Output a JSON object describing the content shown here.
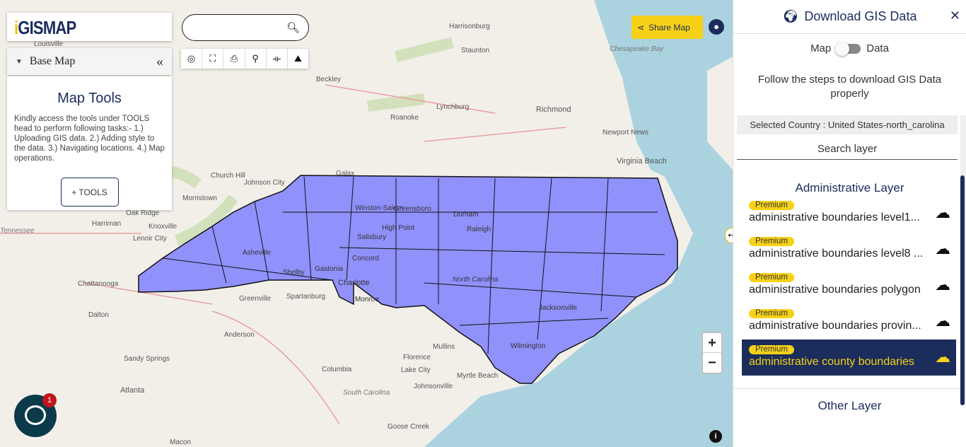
{
  "map": {
    "labels": [
      "Louisville",
      "Harrisonburg",
      "Staunton",
      "Beckley",
      "Lynchburg",
      "Roanoke",
      "Richmond",
      "Chesapeake Bay",
      "Newport News",
      "Virginia Beach",
      "Galax",
      "Church Hill",
      "Johnson City",
      "Morristown",
      "Oak Ridge",
      "Knoxville",
      "Harriman",
      "Lenoir City",
      "Tennessee",
      "Chattanooga",
      "Dalton",
      "Greenville",
      "Spartanburg",
      "Anderson",
      "Atlanta",
      "Sandy Springs",
      "Winston-Salem",
      "Greensboro",
      "Durham",
      "Raleigh",
      "High Point",
      "Salisbury",
      "Asheville",
      "Shelby",
      "Gastonia",
      "Charlotte",
      "Concord",
      "Monroe",
      "Jacksonville",
      "Wilmington",
      "Florence",
      "Lake City",
      "Johnsonville",
      "Myrtle Beach",
      "Mullins",
      "Columbia",
      "South Carolina",
      "North Carolina",
      "Goose Creek",
      "Macon"
    ],
    "region_fill": "#8080ff",
    "region_stroke": "#111111"
  },
  "logo": "iGISMAP",
  "basemap": {
    "label": "Base Map"
  },
  "tools": {
    "title": "Map Tools",
    "description": "Kindly access the tools under TOOLS head to perform following tasks:- 1.) Uploading GIS data. 2.) Adding style to the data. 3.) Navigating locations. 4.) Map operations.",
    "button": "+ TOOLS"
  },
  "search": {
    "placeholder": "",
    "value": ""
  },
  "toolbar": [
    "locate-icon",
    "focus-icon",
    "print-icon",
    "search-icon",
    "measure-icon",
    "layers-icon"
  ],
  "share": {
    "label": "Share Map"
  },
  "chat": {
    "badge": "1"
  },
  "panel": {
    "title": "Download GIS Data",
    "toggle_left": "Map",
    "toggle_right": "Data",
    "steps": "Follow the steps to download GIS Data properly",
    "selected": "Selected Country : United States-north_carolina",
    "search_layer": "Search layer",
    "admin_title": "Administrative Layer",
    "layers": [
      {
        "badge": "Premium",
        "name": "administrative boundaries level1..."
      },
      {
        "badge": "Premium",
        "name": "administrative boundaries level8 ..."
      },
      {
        "badge": "Premium",
        "name": "administrative boundaries polygon"
      },
      {
        "badge": "Premium",
        "name": "administrative boundaries provin..."
      },
      {
        "badge": "Premium",
        "name": "administrative county boundaries",
        "active": true
      }
    ],
    "other_title": "Other Layer"
  },
  "colors": {
    "accent": "#f7d117",
    "brand": "#1b2d5b"
  }
}
